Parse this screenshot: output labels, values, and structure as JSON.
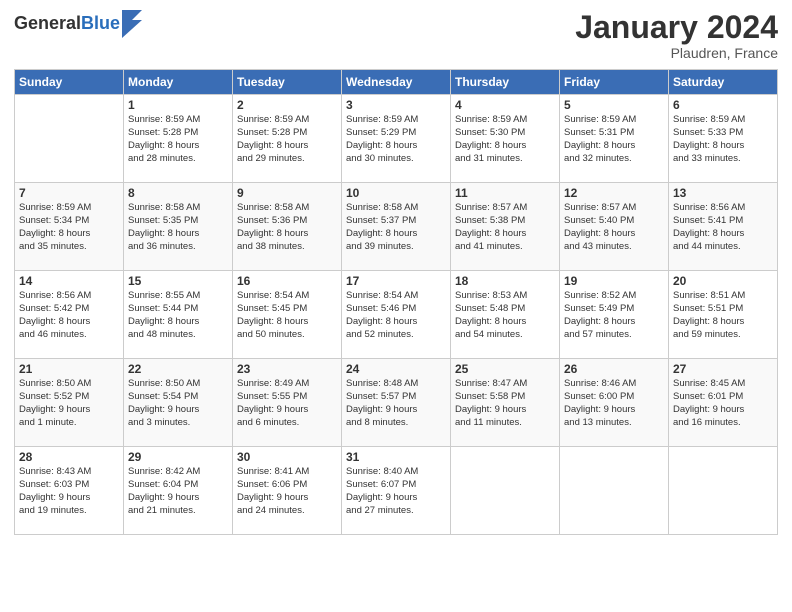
{
  "logo": {
    "general": "General",
    "blue": "Blue"
  },
  "header": {
    "month": "January 2024",
    "location": "Plaudren, France"
  },
  "days_of_week": [
    "Sunday",
    "Monday",
    "Tuesday",
    "Wednesday",
    "Thursday",
    "Friday",
    "Saturday"
  ],
  "weeks": [
    [
      {
        "day": "",
        "content": ""
      },
      {
        "day": "1",
        "content": "Sunrise: 8:59 AM\nSunset: 5:28 PM\nDaylight: 8 hours\nand 28 minutes."
      },
      {
        "day": "2",
        "content": "Sunrise: 8:59 AM\nSunset: 5:28 PM\nDaylight: 8 hours\nand 29 minutes."
      },
      {
        "day": "3",
        "content": "Sunrise: 8:59 AM\nSunset: 5:29 PM\nDaylight: 8 hours\nand 30 minutes."
      },
      {
        "day": "4",
        "content": "Sunrise: 8:59 AM\nSunset: 5:30 PM\nDaylight: 8 hours\nand 31 minutes."
      },
      {
        "day": "5",
        "content": "Sunrise: 8:59 AM\nSunset: 5:31 PM\nDaylight: 8 hours\nand 32 minutes."
      },
      {
        "day": "6",
        "content": "Sunrise: 8:59 AM\nSunset: 5:33 PM\nDaylight: 8 hours\nand 33 minutes."
      }
    ],
    [
      {
        "day": "7",
        "content": "Sunrise: 8:59 AM\nSunset: 5:34 PM\nDaylight: 8 hours\nand 35 minutes."
      },
      {
        "day": "8",
        "content": "Sunrise: 8:58 AM\nSunset: 5:35 PM\nDaylight: 8 hours\nand 36 minutes."
      },
      {
        "day": "9",
        "content": "Sunrise: 8:58 AM\nSunset: 5:36 PM\nDaylight: 8 hours\nand 38 minutes."
      },
      {
        "day": "10",
        "content": "Sunrise: 8:58 AM\nSunset: 5:37 PM\nDaylight: 8 hours\nand 39 minutes."
      },
      {
        "day": "11",
        "content": "Sunrise: 8:57 AM\nSunset: 5:38 PM\nDaylight: 8 hours\nand 41 minutes."
      },
      {
        "day": "12",
        "content": "Sunrise: 8:57 AM\nSunset: 5:40 PM\nDaylight: 8 hours\nand 43 minutes."
      },
      {
        "day": "13",
        "content": "Sunrise: 8:56 AM\nSunset: 5:41 PM\nDaylight: 8 hours\nand 44 minutes."
      }
    ],
    [
      {
        "day": "14",
        "content": "Sunrise: 8:56 AM\nSunset: 5:42 PM\nDaylight: 8 hours\nand 46 minutes."
      },
      {
        "day": "15",
        "content": "Sunrise: 8:55 AM\nSunset: 5:44 PM\nDaylight: 8 hours\nand 48 minutes."
      },
      {
        "day": "16",
        "content": "Sunrise: 8:54 AM\nSunset: 5:45 PM\nDaylight: 8 hours\nand 50 minutes."
      },
      {
        "day": "17",
        "content": "Sunrise: 8:54 AM\nSunset: 5:46 PM\nDaylight: 8 hours\nand 52 minutes."
      },
      {
        "day": "18",
        "content": "Sunrise: 8:53 AM\nSunset: 5:48 PM\nDaylight: 8 hours\nand 54 minutes."
      },
      {
        "day": "19",
        "content": "Sunrise: 8:52 AM\nSunset: 5:49 PM\nDaylight: 8 hours\nand 57 minutes."
      },
      {
        "day": "20",
        "content": "Sunrise: 8:51 AM\nSunset: 5:51 PM\nDaylight: 8 hours\nand 59 minutes."
      }
    ],
    [
      {
        "day": "21",
        "content": "Sunrise: 8:50 AM\nSunset: 5:52 PM\nDaylight: 9 hours\nand 1 minute."
      },
      {
        "day": "22",
        "content": "Sunrise: 8:50 AM\nSunset: 5:54 PM\nDaylight: 9 hours\nand 3 minutes."
      },
      {
        "day": "23",
        "content": "Sunrise: 8:49 AM\nSunset: 5:55 PM\nDaylight: 9 hours\nand 6 minutes."
      },
      {
        "day": "24",
        "content": "Sunrise: 8:48 AM\nSunset: 5:57 PM\nDaylight: 9 hours\nand 8 minutes."
      },
      {
        "day": "25",
        "content": "Sunrise: 8:47 AM\nSunset: 5:58 PM\nDaylight: 9 hours\nand 11 minutes."
      },
      {
        "day": "26",
        "content": "Sunrise: 8:46 AM\nSunset: 6:00 PM\nDaylight: 9 hours\nand 13 minutes."
      },
      {
        "day": "27",
        "content": "Sunrise: 8:45 AM\nSunset: 6:01 PM\nDaylight: 9 hours\nand 16 minutes."
      }
    ],
    [
      {
        "day": "28",
        "content": "Sunrise: 8:43 AM\nSunset: 6:03 PM\nDaylight: 9 hours\nand 19 minutes."
      },
      {
        "day": "29",
        "content": "Sunrise: 8:42 AM\nSunset: 6:04 PM\nDaylight: 9 hours\nand 21 minutes."
      },
      {
        "day": "30",
        "content": "Sunrise: 8:41 AM\nSunset: 6:06 PM\nDaylight: 9 hours\nand 24 minutes."
      },
      {
        "day": "31",
        "content": "Sunrise: 8:40 AM\nSunset: 6:07 PM\nDaylight: 9 hours\nand 27 minutes."
      },
      {
        "day": "",
        "content": ""
      },
      {
        "day": "",
        "content": ""
      },
      {
        "day": "",
        "content": ""
      }
    ]
  ]
}
